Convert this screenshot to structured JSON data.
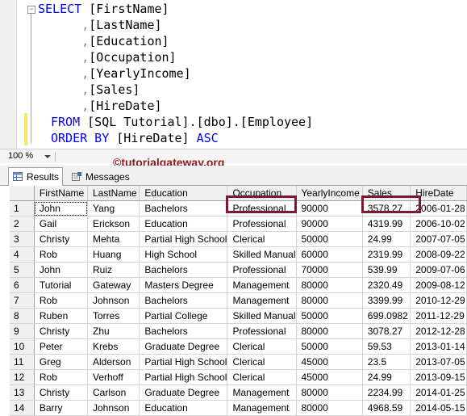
{
  "query": {
    "lines": [
      {
        "kw": "SELECT ",
        "rest": "[FirstName]"
      },
      {
        "indent": "      ",
        "comma": ",",
        "rest": "[LastName]"
      },
      {
        "indent": "      ",
        "comma": ",",
        "rest": "[Education]"
      },
      {
        "indent": "      ",
        "comma": ",",
        "rest": "[Occupation]"
      },
      {
        "indent": "      ",
        "comma": ",",
        "rest": "[YearlyIncome]"
      },
      {
        "indent": "      ",
        "comma": ",",
        "rest": "[Sales]"
      },
      {
        "indent": "      ",
        "comma": ",",
        "rest": "[HireDate]"
      }
    ],
    "from_kw": "FROM",
    "from_rest": "[SQL Tutorial].[dbo].[Employee]",
    "order_kw": "ORDER BY",
    "order_col": "[HireDate]",
    "order_dir": "ASC"
  },
  "zoom": {
    "value": "100 %"
  },
  "watermark": "©tutorialgateway.org",
  "tabs": {
    "results": "Results",
    "messages": "Messages"
  },
  "grid": {
    "columns": [
      "FirstName",
      "LastName",
      "Education",
      "Occupation",
      "YearlyIncome",
      "Sales",
      "HireDate"
    ],
    "rows": [
      [
        "1",
        "John",
        "Yang",
        "Bachelors",
        "Professional",
        "90000",
        "3578.27",
        "2006-01-28"
      ],
      [
        "2",
        "Gail",
        "Erickson",
        "Education",
        "Professional",
        "90000",
        "4319.99",
        "2006-10-02"
      ],
      [
        "3",
        "Christy",
        "Mehta",
        "Partial High School",
        "Clerical",
        "50000",
        "24.99",
        "2007-07-05"
      ],
      [
        "4",
        "Rob",
        "Huang",
        "High School",
        "Skilled Manual",
        "60000",
        "2319.99",
        "2008-09-22"
      ],
      [
        "5",
        "John",
        "Ruiz",
        "Bachelors",
        "Professional",
        "70000",
        "539.99",
        "2009-07-06"
      ],
      [
        "6",
        "Tutorial",
        "Gateway",
        "Masters Degree",
        "Management",
        "80000",
        "2320.49",
        "2009-08-12"
      ],
      [
        "7",
        "Rob",
        "Johnson",
        "Bachelors",
        "Management",
        "80000",
        "3399.99",
        "2010-12-29"
      ],
      [
        "8",
        "Ruben",
        "Torres",
        "Partial College",
        "Skilled Manual",
        "50000",
        "699.0982",
        "2011-12-29"
      ],
      [
        "9",
        "Christy",
        "Zhu",
        "Bachelors",
        "Professional",
        "80000",
        "3078.27",
        "2012-12-28"
      ],
      [
        "10",
        "Peter",
        "Krebs",
        "Graduate Degree",
        "Clerical",
        "50000",
        "59.53",
        "2013-01-14"
      ],
      [
        "11",
        "Greg",
        "Alderson",
        "Partial High School",
        "Clerical",
        "45000",
        "23.5",
        "2013-07-05"
      ],
      [
        "12",
        "Rob",
        "Verhoff",
        "Partial High School",
        "Clerical",
        "45000",
        "24.99",
        "2013-09-15"
      ],
      [
        "13",
        "Christy",
        "Carlson",
        "Graduate Degree",
        "Management",
        "80000",
        "2234.99",
        "2014-01-25"
      ],
      [
        "14",
        "Barry",
        "Johnson",
        "Education",
        "Management",
        "80000",
        "4968.59",
        "2014-05-15"
      ]
    ]
  }
}
